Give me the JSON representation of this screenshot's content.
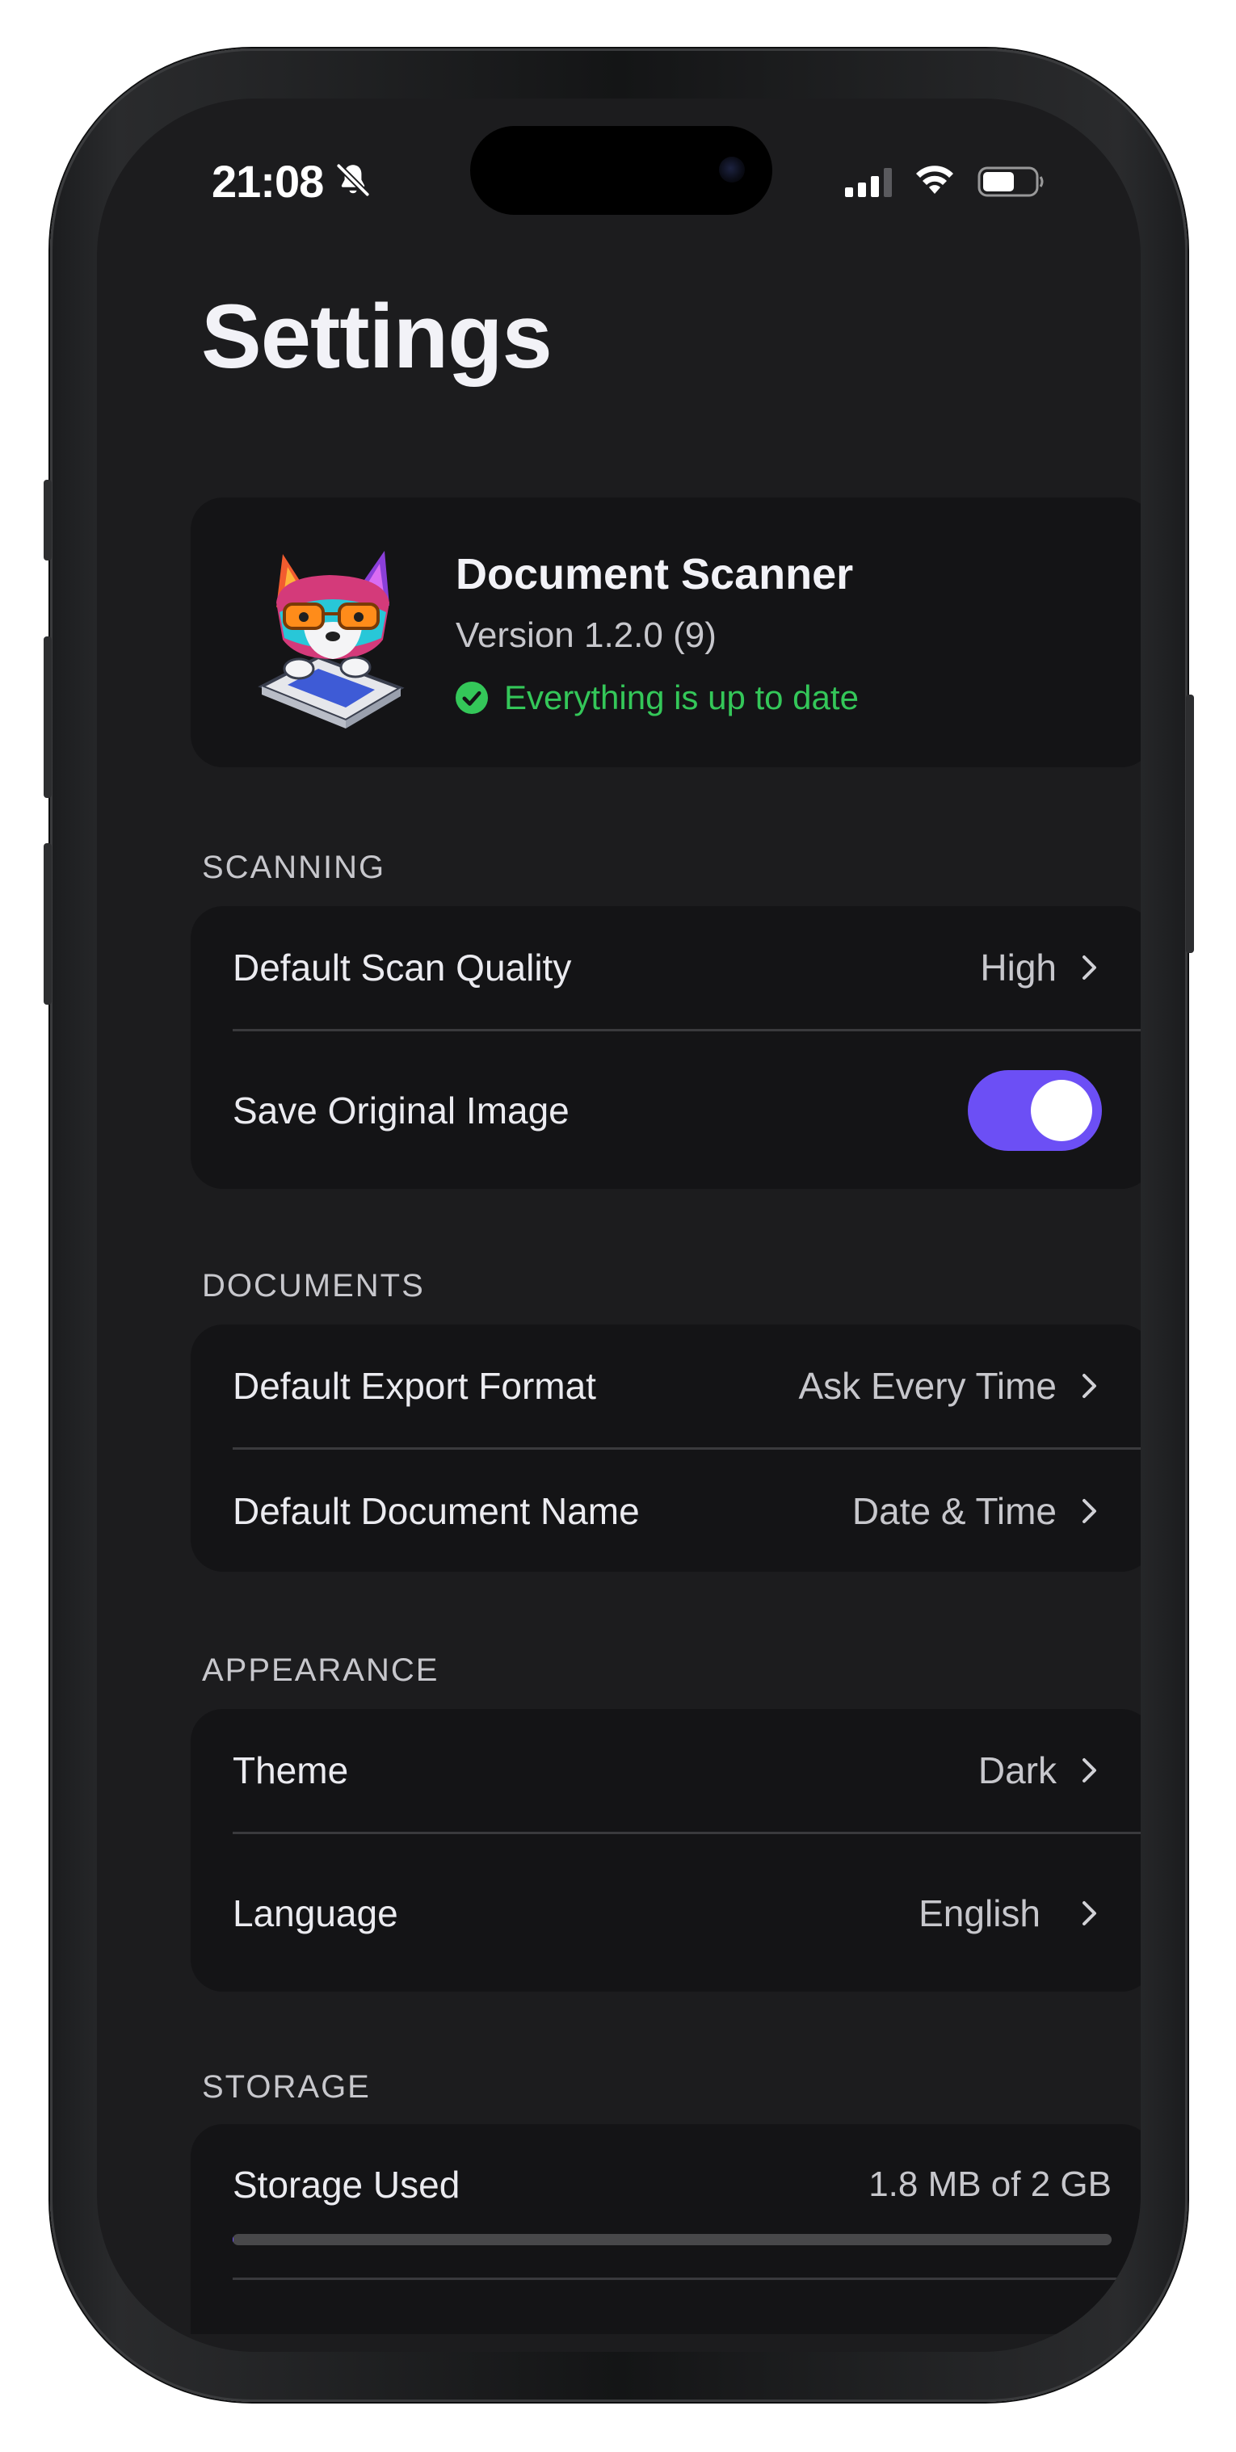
{
  "status_bar": {
    "time": "21:08"
  },
  "page_title": "Settings",
  "app_info": {
    "name": "Document Scanner",
    "version": "Version 1.2.0 (9)",
    "update_status": "Everything is up to date"
  },
  "sections": {
    "scanning": {
      "header": "SCANNING",
      "scan_quality": {
        "label": "Default Scan Quality",
        "value": "High"
      },
      "save_original": {
        "label": "Save Original Image",
        "enabled": true
      }
    },
    "documents": {
      "header": "DOCUMENTS",
      "export_format": {
        "label": "Default Export Format",
        "value": "Ask Every Time"
      },
      "document_name": {
        "label": "Default Document Name",
        "value": "Date & Time"
      }
    },
    "appearance": {
      "header": "APPEARANCE",
      "theme": {
        "label": "Theme",
        "value": "Dark"
      },
      "language": {
        "label": "Language",
        "value": "English"
      }
    },
    "storage": {
      "header": "STORAGE",
      "used": {
        "label": "Storage Used",
        "value": "1.8 MB of 2 GB",
        "fraction": 0.0009
      }
    }
  },
  "colors": {
    "accent": "#6c4ff5",
    "success": "#34c759",
    "background": "#1c1c1e",
    "card": "#141416"
  },
  "icons": [
    "bell-slash-icon",
    "signal-icon",
    "wifi-icon",
    "battery-icon",
    "check-circle-icon",
    "chevron-right-icon"
  ]
}
